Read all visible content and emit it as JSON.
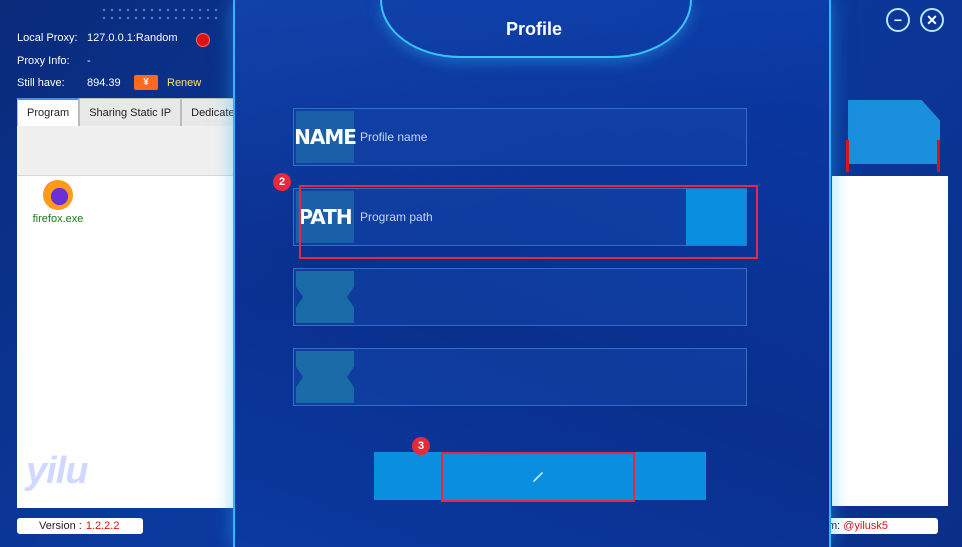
{
  "app": {
    "info": {
      "local_proxy_label": "Local Proxy:",
      "local_proxy_value": "127.0.0.1:Random",
      "proxy_info_label": "Proxy Info:",
      "proxy_info_value": "-",
      "still_have_label": "Still have:",
      "still_have_value": "894.39",
      "yen_symbol": "¥",
      "renew_label": "Renew"
    },
    "tabs": [
      {
        "label": "Program",
        "active": true
      },
      {
        "label": "Sharing Static IP",
        "active": false
      },
      {
        "label": "Dedicated",
        "active": false
      }
    ],
    "programs": [
      {
        "label": "firefox.exe",
        "icon": "firefox-icon"
      }
    ],
    "watermark": "yilu",
    "version_label": "Version :",
    "version_value": "1.2.2.2",
    "contact_label": "m:",
    "contact_value": "@yilusk5",
    "window_buttons": {
      "minimize": "−",
      "close": "✕",
      "modal_close": "✕"
    }
  },
  "modal": {
    "title": "Profile",
    "fields": [
      {
        "tag": "NAME",
        "placeholder": "Profile name"
      },
      {
        "tag": "PATH",
        "placeholder": "Program path"
      },
      {
        "tag": "",
        "placeholder": ""
      },
      {
        "tag": "",
        "placeholder": ""
      }
    ],
    "steps": {
      "path_step": "2",
      "confirm_step": "3"
    }
  },
  "colors": {
    "accent": "#2fb6ff",
    "button": "#0a8fe0",
    "highlight": "#e8283c",
    "tag_bg": "#1a5fa8"
  }
}
